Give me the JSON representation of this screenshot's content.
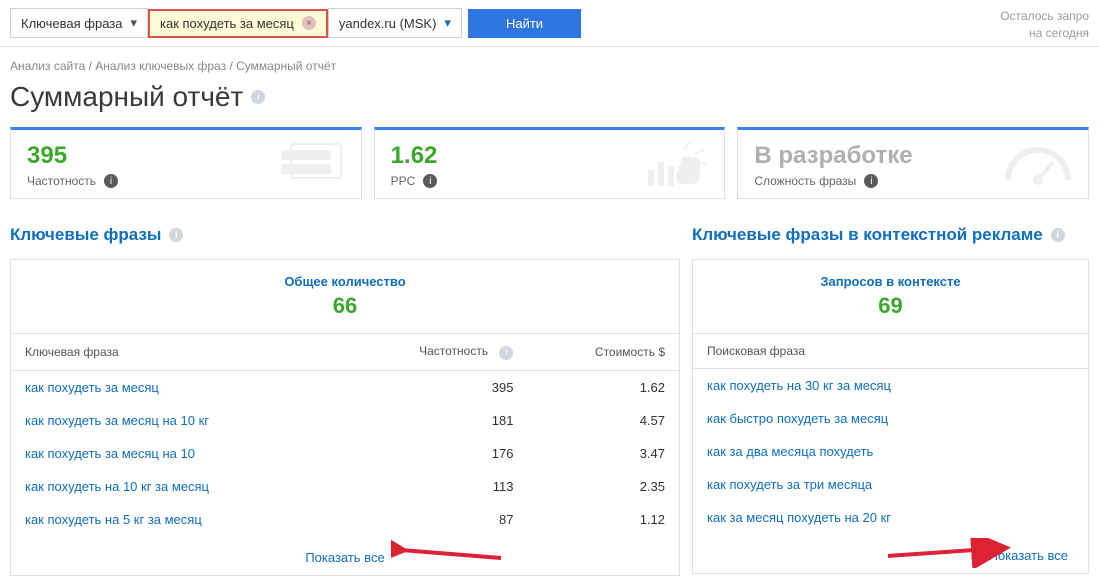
{
  "searchbar": {
    "mode": "Ключевая фраза",
    "query": "как похудеть за месяц",
    "engine": "yandex.ru (MSK)",
    "find_label": "Найти",
    "remaining_l1": "Осталось запро",
    "remaining_l2": "на сегодня"
  },
  "breadcrumb": {
    "a": "Анализ сайта",
    "b": "Анализ ключевых фраз",
    "c": "Суммарный отчёт"
  },
  "title": "Суммарный отчёт",
  "cards": {
    "frequency": {
      "value": "395",
      "label": "Частотность"
    },
    "ppc": {
      "value": "1.62",
      "label": "PPC"
    },
    "difficulty": {
      "value": "В разработке",
      "label": "Сложность фразы"
    }
  },
  "left": {
    "title": "Ключевые фразы",
    "panel_label": "Общее количество",
    "panel_count": "66",
    "headers": {
      "phrase": "Ключевая фраза",
      "freq": "Частотность",
      "cost": "Стоимость $"
    },
    "rows": [
      {
        "phrase": "как похудеть за месяц",
        "freq": "395",
        "cost": "1.62"
      },
      {
        "phrase": "как похудеть за месяц на 10 кг",
        "freq": "181",
        "cost": "4.57"
      },
      {
        "phrase": "как похудеть за месяц на 10",
        "freq": "176",
        "cost": "3.47"
      },
      {
        "phrase": "как похудеть на 10 кг за месяц",
        "freq": "113",
        "cost": "2.35"
      },
      {
        "phrase": "как похудеть на 5 кг за месяц",
        "freq": "87",
        "cost": "1.12"
      }
    ],
    "show_all": "Показать все"
  },
  "right": {
    "title": "Ключевые фразы в контекстной рекламе",
    "panel_label": "Запросов в контексте",
    "panel_count": "69",
    "headers": {
      "phrase": "Поисковая фраза"
    },
    "rows": [
      {
        "phrase": "как похудеть на 30 кг за месяц"
      },
      {
        "phrase": "как быстро похудеть за месяц"
      },
      {
        "phrase": "как за два месяца похудеть"
      },
      {
        "phrase": "как похудеть за три месяца"
      },
      {
        "phrase": "как за месяц похудеть на 20 кг"
      }
    ],
    "show_all": "Показать все"
  }
}
